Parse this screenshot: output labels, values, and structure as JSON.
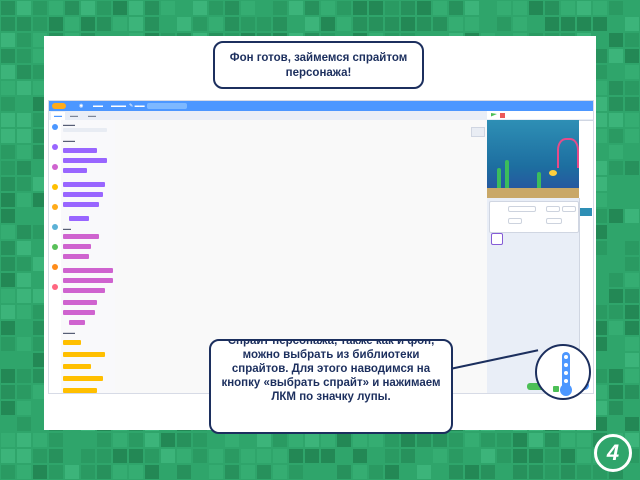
{
  "slide": {
    "callout_top": "Фон готов, займемся спрайтом персонажа!",
    "callout_bottom": "Спрайт персонажа, также как и фон, можно выбрать из библиотеки спрайтов. Для этого наводимся на кнопку «выбрать спрайт» и нажимаем ЛКМ по значку лупы.",
    "page_number": "4"
  },
  "colors": {
    "background_green": "#2fa56b",
    "scratch_blue": "#4c97ff",
    "callout_border": "#1c2f5e"
  },
  "icons": {
    "search": "magnifier-icon",
    "green_flag": "green-flag-icon",
    "stop": "stop-icon",
    "choose_sprite": "cat-sprite-icon",
    "choose_backdrop": "backdrop-icon"
  }
}
